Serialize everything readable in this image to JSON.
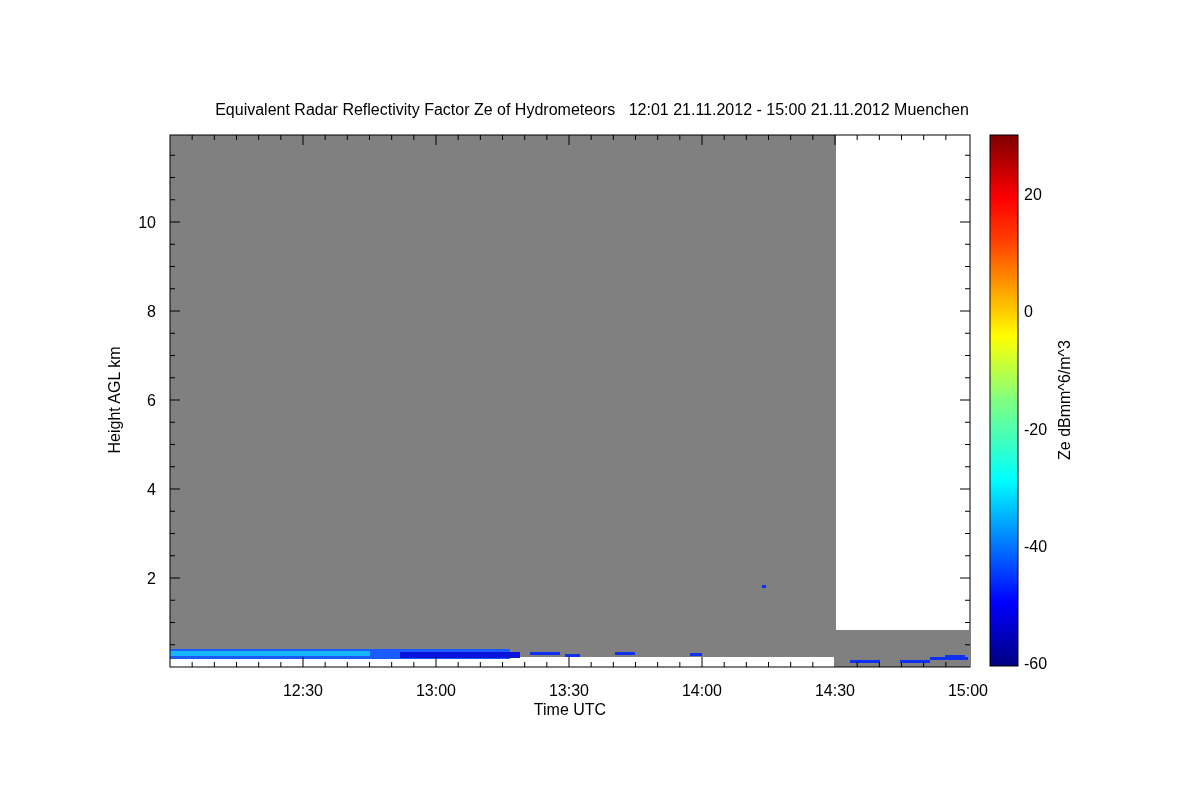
{
  "title": "Equivalent Radar Reflectivity Factor Ze of Hydrometeors   12:01 21.11.2012 - 15:00 21.11.2012 Muenchen",
  "y_axis": {
    "label": "Height AGL km",
    "ticks": [
      "10",
      "8",
      "6",
      "4",
      "2"
    ]
  },
  "x_axis": {
    "label": "Time UTC",
    "ticks": [
      "12:30",
      "13:00",
      "13:30",
      "14:00",
      "14:30",
      "15:00"
    ]
  },
  "colorbar": {
    "label": "Ze dBmm^6/m^3",
    "ticks": [
      "20",
      "0",
      "-20",
      "-40",
      "-60"
    ]
  }
}
